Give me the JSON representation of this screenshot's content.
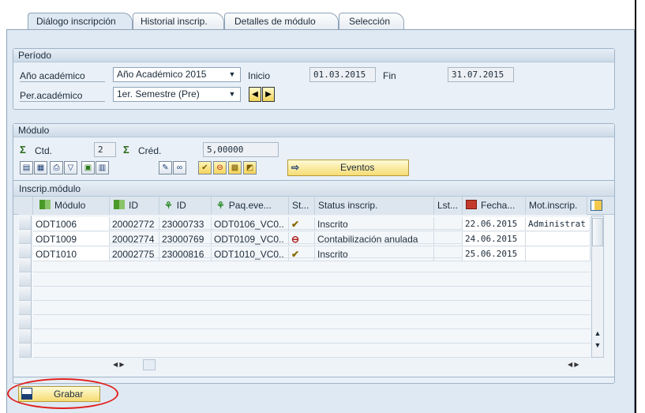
{
  "tabs": [
    {
      "label": "Diálogo inscripción",
      "active": true
    },
    {
      "label": "Historial inscrip.",
      "active": false
    },
    {
      "label": "Detalles de módulo",
      "active": false
    },
    {
      "label": "Selección",
      "active": false
    }
  ],
  "periodo": {
    "title": "Período",
    "anio_label": "Año académico",
    "anio_value": "Año Académico 2015",
    "inicio_label": "Inicio",
    "inicio_value": "01.03.2015",
    "fin_label": "Fin",
    "fin_value": "31.07.2015",
    "per_label": "Per.académico",
    "per_value": "1er. Semestre (Pre)"
  },
  "modulo": {
    "title": "Módulo",
    "ctd_label": "Ctd.",
    "ctd_value": "2",
    "cred_label": "Créd.",
    "cred_value": "5,00000",
    "eventos_label": "Eventos"
  },
  "grid": {
    "title": "Inscrip.módulo",
    "columns": [
      "Módulo",
      "ID",
      "ID",
      "Paq.eve...",
      "St...",
      "Status inscrip.",
      "Lst...",
      "Fecha...",
      "Mot.inscrip."
    ],
    "rows": [
      {
        "modulo": "ODT1006",
        "id1": "20002772",
        "id2": "23000733",
        "paq": "ODT0106_VC0..",
        "status": "Inscrito",
        "fecha": "22.06.2015",
        "mot": "Administrat"
      },
      {
        "modulo": "ODT1009",
        "id1": "20002774",
        "id2": "23000769",
        "paq": "ODT0109_VC0..",
        "status": "Contabilización anulada",
        "fecha": "24.06.2015",
        "mot": ""
      },
      {
        "modulo": "ODT1010",
        "id1": "20002775",
        "id2": "23000816",
        "paq": "ODT1010_VC0..",
        "status": "Inscrito",
        "fecha": "25.06.2015",
        "mot": ""
      }
    ]
  },
  "footer": {
    "save_label": "Grabar"
  },
  "colors": {
    "panel_bg": "#dfe9f3",
    "highlight_ring": "#e0201c",
    "button_yellow": "#f6dc73"
  },
  "icons": {
    "save": "floppy-disk-icon",
    "sum": "sigma-icon",
    "nav_prev": "triangle-left-icon",
    "nav_next": "triangle-right-icon",
    "eventos": "arrow-right-icon"
  }
}
